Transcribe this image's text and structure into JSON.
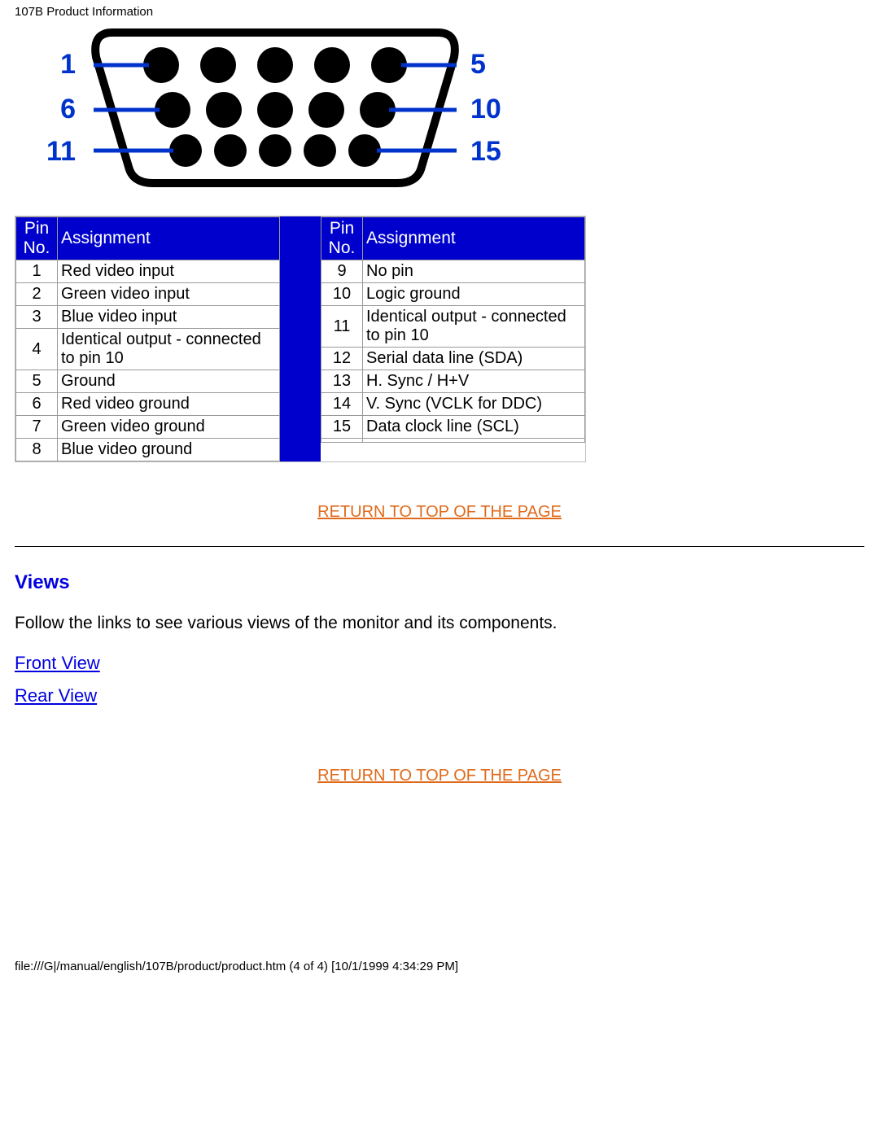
{
  "header": "107B Product Information",
  "diagram": {
    "left_labels": [
      "1",
      "6",
      "11"
    ],
    "right_labels": [
      "5",
      "10",
      "15"
    ]
  },
  "table_headers": {
    "pin_no": "Pin No.",
    "assignment": "Assignment"
  },
  "pins_left": [
    {
      "no": "1",
      "assign": "Red video input"
    },
    {
      "no": "2",
      "assign": "Green video input"
    },
    {
      "no": "3",
      "assign": "Blue video input"
    },
    {
      "no": "4",
      "assign": "Identical output - connected to pin 10"
    },
    {
      "no": "5",
      "assign": "Ground"
    },
    {
      "no": "6",
      "assign": "Red video ground"
    },
    {
      "no": "7",
      "assign": "Green video ground"
    },
    {
      "no": "8",
      "assign": "Blue video ground"
    }
  ],
  "pins_right": [
    {
      "no": "9",
      "assign": "No pin"
    },
    {
      "no": "10",
      "assign": "Logic ground"
    },
    {
      "no": "11",
      "assign": "Identical output - connected to pin 10"
    },
    {
      "no": "12",
      "assign": "Serial data line (SDA)"
    },
    {
      "no": "13",
      "assign": "H. Sync / H+V"
    },
    {
      "no": "14",
      "assign": "V. Sync (VCLK for DDC)"
    },
    {
      "no": "15",
      "assign": "Data clock line (SCL)"
    },
    {
      "no": "",
      "assign": ""
    }
  ],
  "links": {
    "return_top": "RETURN TO TOP OF THE PAGE",
    "front_view": "Front View",
    "rear_view": "Rear View"
  },
  "views_section": {
    "heading": "Views",
    "body": "Follow the links to see various views of the monitor and its components."
  },
  "footer": "file:///G|/manual/english/107B/product/product.htm (4 of 4) [10/1/1999 4:34:29 PM]"
}
